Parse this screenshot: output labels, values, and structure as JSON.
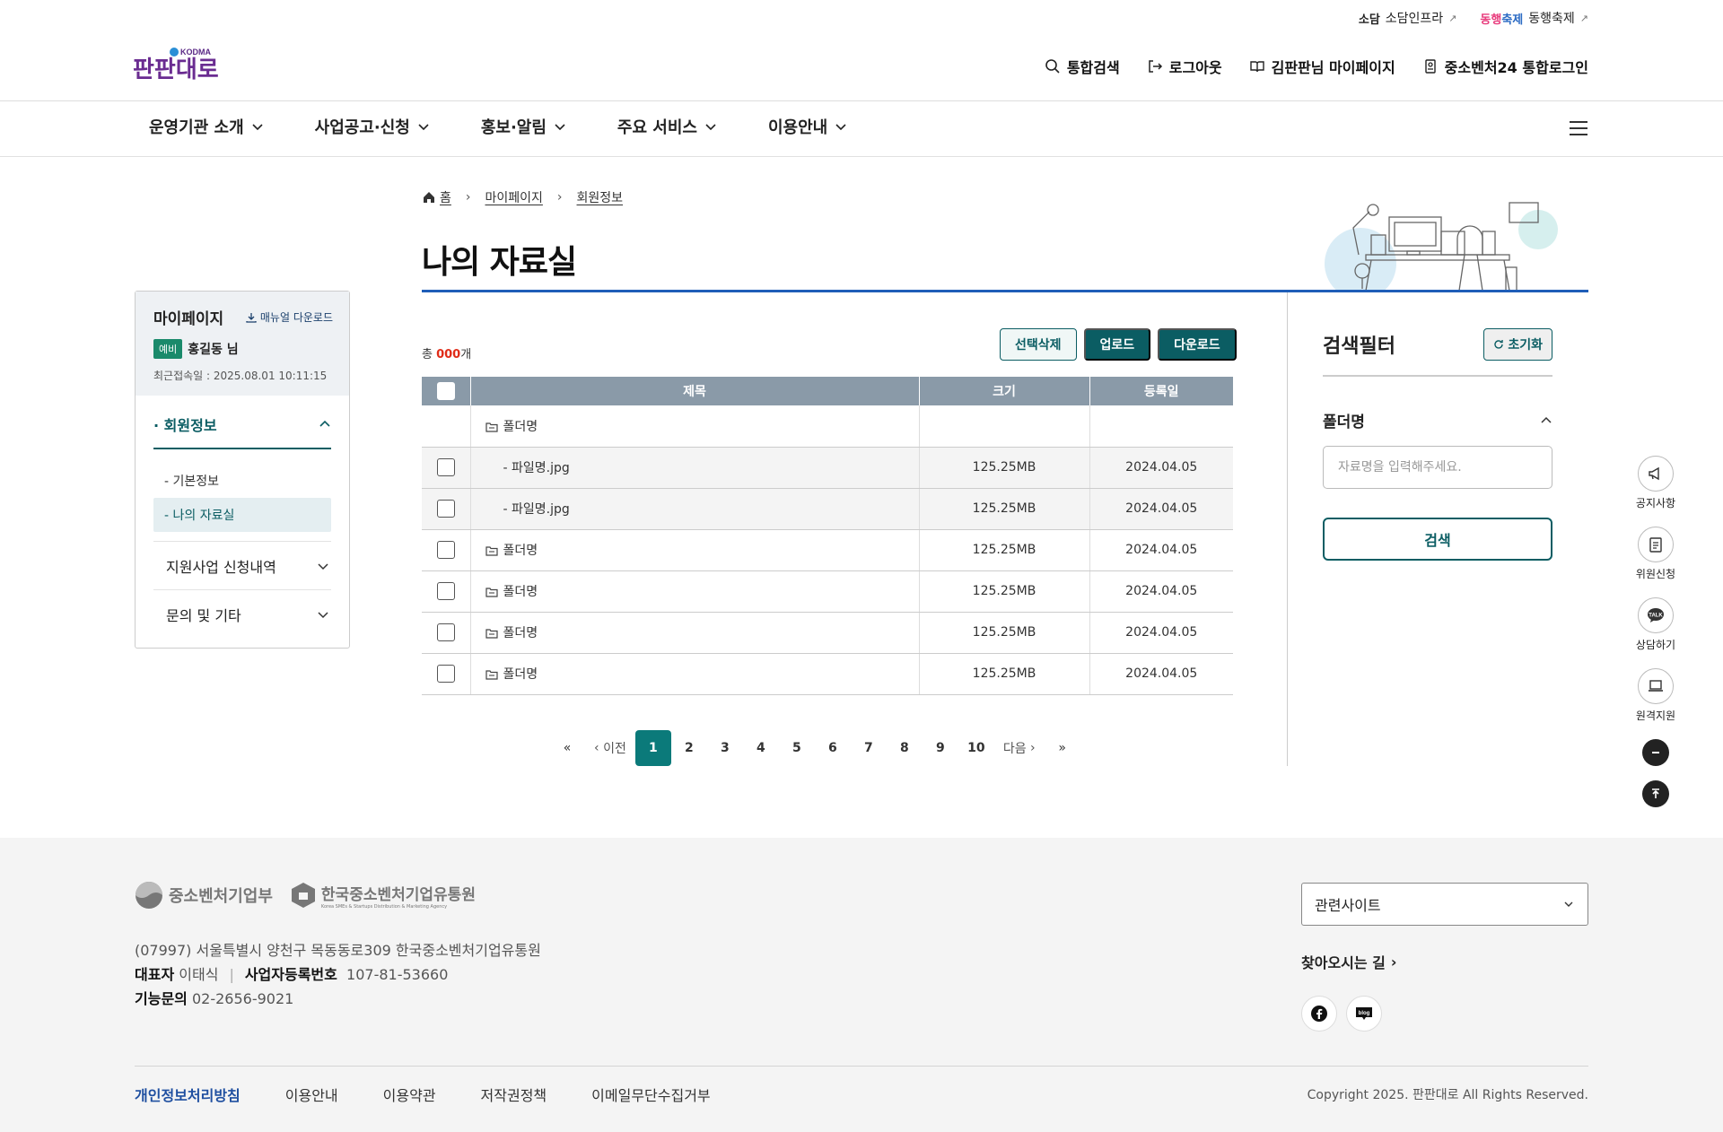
{
  "util_links": [
    {
      "brand": "소담",
      "label": "소담인프라"
    },
    {
      "brand": "동행축제",
      "label": "동행축제"
    }
  ],
  "logo": {
    "mark": "KODMA",
    "text": "판판대로"
  },
  "gnb": [
    "통합검색",
    "로그아웃",
    "김판판님 마이페이지",
    "중소벤처24 통합로그인"
  ],
  "menu": [
    "운영기관 소개",
    "사업공고·신청",
    "홍보·알림",
    "주요 서비스",
    "이용안내"
  ],
  "breadcrumb": [
    "홈",
    "마이페이지",
    "회원정보"
  ],
  "page_title": "나의 자료실",
  "sidebar": {
    "title": "마이페이지",
    "manual": "매뉴얼 다운로드",
    "badge": "예비",
    "user": "홍길동 님",
    "last_login": "최근접속일 : 2025.08.01 10:11:15",
    "section": "회원정보",
    "sub": [
      "- 기본정보",
      "- 나의 자료실"
    ],
    "others": [
      "지원사업 신청내역",
      "문의 및 기타"
    ]
  },
  "total": {
    "prefix": "총 ",
    "count": "000",
    "suffix": "개"
  },
  "buttons": {
    "delete": "선택삭제",
    "upload": "업로드",
    "download": "다운로드"
  },
  "table": {
    "headers": [
      "제목",
      "크기",
      "등록일"
    ],
    "rows": [
      {
        "name": "폴더명",
        "size": "",
        "date": ""
      },
      {
        "name": "- 파일명.jpg",
        "size": "125.25MB",
        "date": "2024.04.05"
      },
      {
        "name": "- 파일명.jpg",
        "size": "125.25MB",
        "date": "2024.04.05"
      },
      {
        "name": "폴더명",
        "size": "125.25MB",
        "date": "2024.04.05"
      },
      {
        "name": "폴더명",
        "size": "125.25MB",
        "date": "2024.04.05"
      },
      {
        "name": "폴더명",
        "size": "125.25MB",
        "date": "2024.04.05"
      },
      {
        "name": "폴더명",
        "size": "125.25MB",
        "date": "2024.04.05"
      }
    ]
  },
  "pagination": {
    "prev": "이전",
    "next": "다음",
    "pages": [
      "1",
      "2",
      "3",
      "4",
      "5",
      "6",
      "7",
      "8",
      "9",
      "10"
    ],
    "current": "1"
  },
  "filter": {
    "title": "검색필터",
    "reset": "초기화",
    "field": "폴더명",
    "placeholder": "자료명을 입력해주세요.",
    "search": "검색"
  },
  "quick": [
    "공지사항",
    "위원신청",
    "상담하기",
    "원격지원"
  ],
  "footer": {
    "org1": "중소벤처기업부",
    "org2": "한국중소벤처기업유통원",
    "org2_en": "Korea SMEs & Startups Distribution & Marketing Agency",
    "address": "(07997) 서울특별시 양천구 목동동로309 한국중소벤처기업유통원",
    "rep_label": "대표자",
    "rep": "이태식",
    "biz_label": "사업자등록번호",
    "biz": "107-81-53660",
    "tel_label": "기능문의",
    "tel": "02-2656-9021",
    "related": "관련사이트",
    "directions": "찾아오시는 길",
    "links": [
      "개인정보처리방침",
      "이용안내",
      "이용약관",
      "저작권정책",
      "이메일무단수집거부"
    ],
    "copyright": "Copyright 2025. 판판대로 All Rights Reserved."
  },
  "colors": {
    "primary": "#0b5d63",
    "accent_blue": "#1f5eb8",
    "total_red": "#e02c18"
  }
}
